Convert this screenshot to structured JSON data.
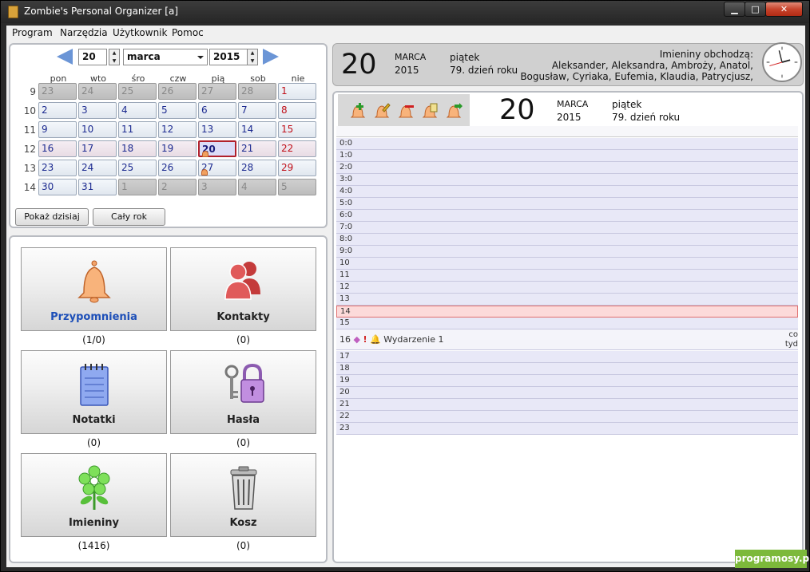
{
  "window": {
    "title": "Zombie's Personal Organizer [a]",
    "minimize": "▁",
    "maximize": "□",
    "close": "✕"
  },
  "menu": [
    "Program",
    "Narzędzia",
    "Użytkownik",
    "Pomoc"
  ],
  "calendar": {
    "day": "20",
    "month": "marca",
    "year": "2015",
    "weekdays": [
      "pon",
      "wto",
      "śro",
      "czw",
      "pią",
      "sob",
      "nie"
    ],
    "weeks": [
      {
        "num": "9",
        "days": [
          "23",
          "24",
          "25",
          "26",
          "27",
          "28",
          "1"
        ]
      },
      {
        "num": "10",
        "days": [
          "2",
          "3",
          "4",
          "5",
          "6",
          "7",
          "8"
        ]
      },
      {
        "num": "11",
        "days": [
          "9",
          "10",
          "11",
          "12",
          "13",
          "14",
          "15"
        ]
      },
      {
        "num": "12",
        "days": [
          "16",
          "17",
          "18",
          "19",
          "20",
          "21",
          "22"
        ]
      },
      {
        "num": "13",
        "days": [
          "23",
          "24",
          "25",
          "26",
          "27",
          "28",
          "29"
        ]
      },
      {
        "num": "14",
        "days": [
          "30",
          "31",
          "1",
          "2",
          "3",
          "4",
          "5"
        ]
      }
    ],
    "btn_today": "Pokaż dzisiaj",
    "btn_year": "Cały rok"
  },
  "modules": [
    {
      "label": "Przypomnienia",
      "count": "(1/0)",
      "icon": "bell-icon"
    },
    {
      "label": "Kontakty",
      "count": "(0)",
      "icon": "contacts-icon"
    },
    {
      "label": "Notatki",
      "count": "(0)",
      "icon": "notepad-icon"
    },
    {
      "label": "Hasła",
      "count": "(0)",
      "icon": "padlock-key-icon"
    },
    {
      "label": "Imieniny",
      "count": "(1416)",
      "icon": "flower-icon"
    },
    {
      "label": "Kosz",
      "count": "(0)",
      "icon": "trash-icon"
    }
  ],
  "header": {
    "day": "20",
    "month": "MARCA",
    "year": "2015",
    "weekday": "piątek",
    "day_of_year": "79. dzień roku",
    "names_title": "Imieniny obchodzą:",
    "names_line1": "Aleksander, Aleksandra, Ambroży, Anatol,",
    "names_line2": "Bogusław, Cyriaka, Eufemia, Klaudia, Patrycjusz,"
  },
  "schedule": {
    "day": "20",
    "month": "MARCA",
    "year": "2015",
    "weekday": "piątek",
    "day_of_year": "79. dzień roku",
    "hours": [
      "0:0",
      "1:0",
      "2:0",
      "3:0",
      "4:0",
      "5:0",
      "6:0",
      "7:0",
      "8:0",
      "9:0",
      "10",
      "11",
      "12",
      "13",
      "14",
      "15",
      "16",
      "17",
      "18",
      "19",
      "20",
      "21",
      "22",
      "23"
    ],
    "current_hour": "14",
    "event": {
      "hour": "16",
      "title": "Wydarzenie 1",
      "cut_right_1": "co",
      "cut_right_2": "tyd"
    }
  },
  "watermark": "programosy.pl"
}
